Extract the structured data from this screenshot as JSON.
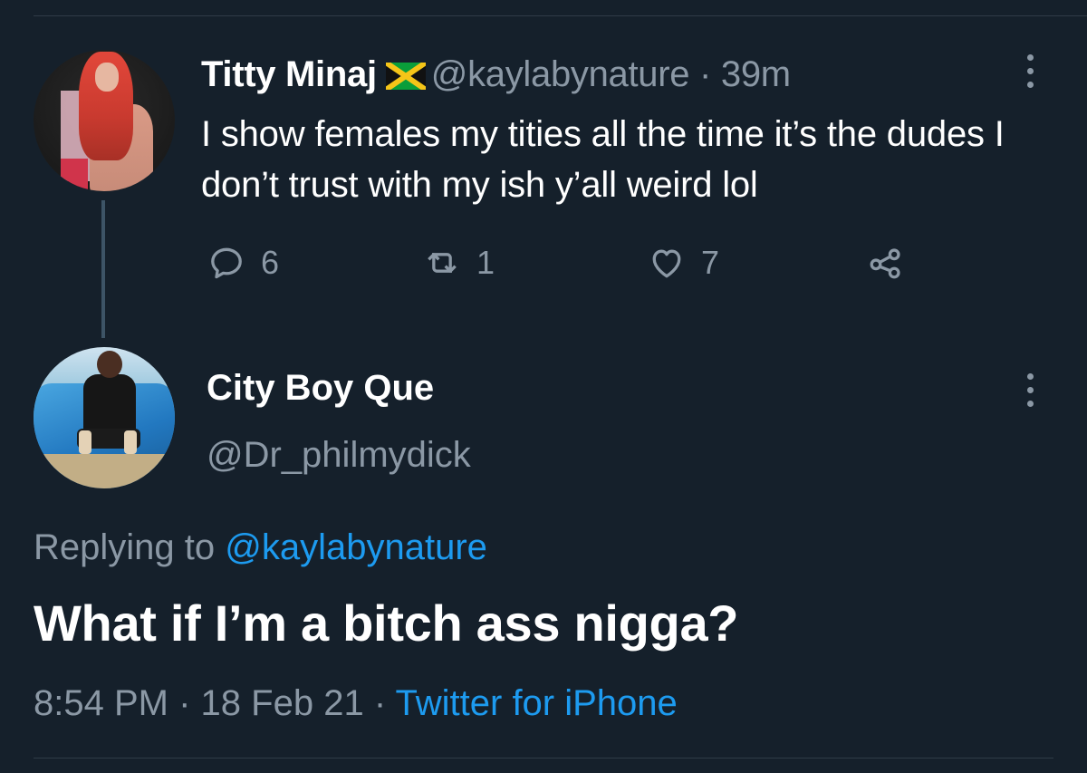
{
  "tweet_parent": {
    "display_name": "Titty Minaj",
    "flag_icon": "jamaica-flag-icon",
    "handle": "@kaylabynature",
    "separator": "·",
    "time_ago": "39m",
    "text": "I show females my tities all the time it’s the dudes I don’t trust with my ish y’all weird lol",
    "reply_count": "6",
    "retweet_count": "1",
    "like_count": "7"
  },
  "tweet_main": {
    "display_name": "City Boy Que",
    "handle": "@Dr_philmydick",
    "replying_prefix": "Replying to",
    "replying_to": "@kaylabynature",
    "text": "What if I’m a bitch ass nigga?",
    "time": "8:54 PM",
    "separator1": "·",
    "date": "18 Feb 21",
    "separator2": "·",
    "source": "Twitter for iPhone"
  },
  "colors": {
    "background": "#15202b",
    "text_primary": "#ffffff",
    "text_secondary": "#8b98a5",
    "accent": "#1d9bf0",
    "thread_line": "#3d5466"
  }
}
